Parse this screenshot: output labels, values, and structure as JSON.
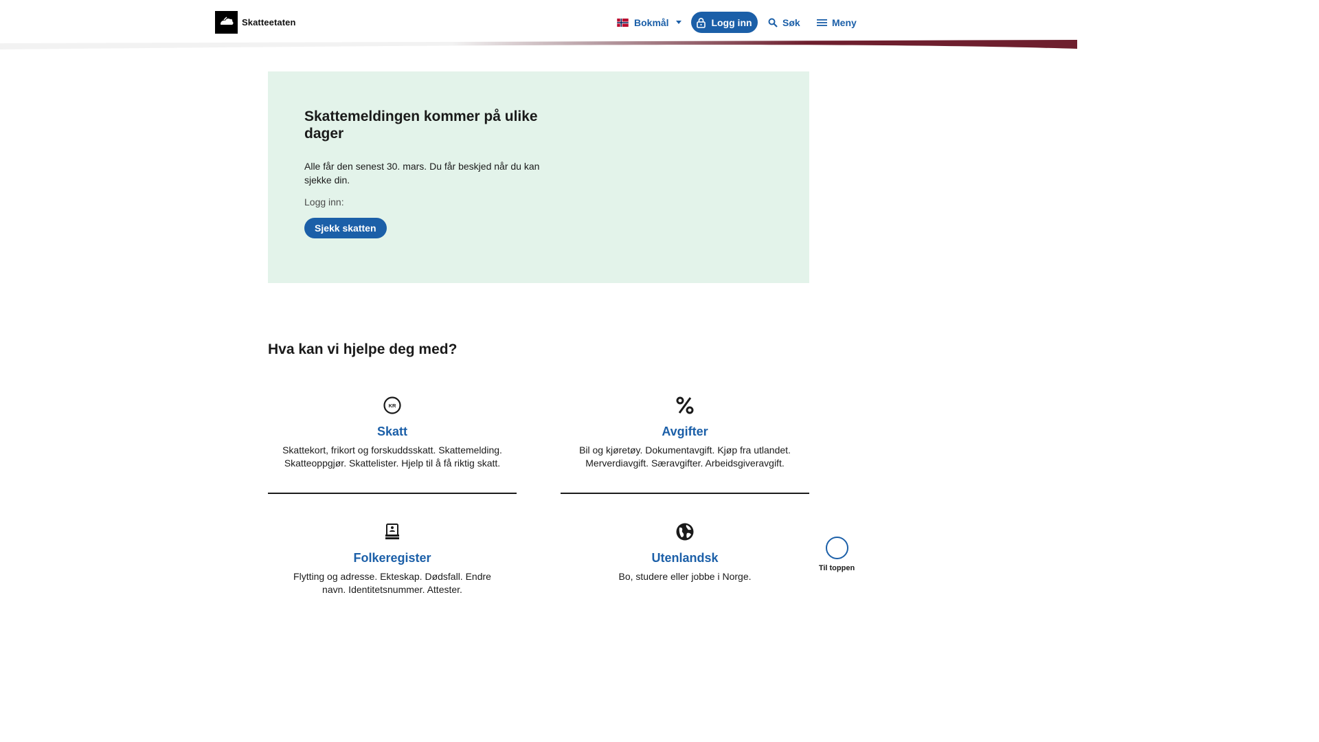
{
  "header": {
    "logo_text": "Skatteetaten",
    "language": {
      "label": "Bokmål",
      "flag": "norway-flag-icon"
    },
    "login_label": "Logg inn",
    "search_label": "Søk",
    "menu_label": "Meny"
  },
  "hero": {
    "title": "Skattemeldingen kommer på ulike dager",
    "lead": "Alle får den senest 30. mars. Du får beskjed når du kan sjekke din.",
    "login_label": "Logg inn:",
    "cta_label": "Sjekk skatten",
    "background": "#e3f3ea"
  },
  "help": {
    "title": "Hva kan vi hjelpe deg med?",
    "tiles": [
      {
        "icon": "kr-coin-icon",
        "title": "Skatt",
        "description": "Skattekort, frikort og forskuddsskatt. Skattemelding. Skatteoppgjør. Skattelister. Hjelp til å få riktig skatt."
      },
      {
        "icon": "percent-icon",
        "title": "Avgifter",
        "description": "Bil og kjøretøy. Dokumentavgift. Kjøp fra utlandet. Merverdiavgift. Særavgifter. Arbeidsgiveravgift."
      },
      {
        "icon": "registry-icon",
        "title": "Folkeregister",
        "description": "Flytting og adresse. Ekteskap. Dødsfall. Endre navn. Identitetsnummer. Attester."
      },
      {
        "icon": "globe-icon",
        "title": "Utenlandsk",
        "description": "Bo, studere eller jobbe i Norge."
      }
    ]
  },
  "to_top": {
    "label": "Til toppen"
  },
  "colors": {
    "accent": "#1b5fa8",
    "brand_swoosh": "#6e1f2e"
  }
}
